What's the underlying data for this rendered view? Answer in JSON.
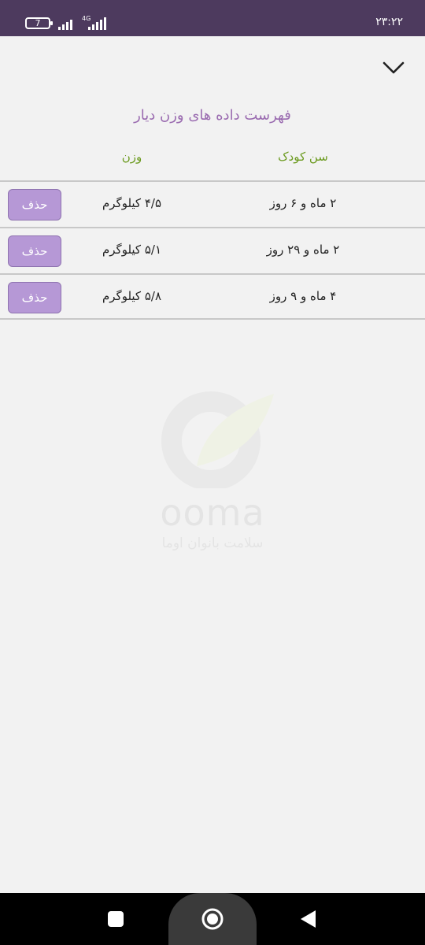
{
  "status_bar": {
    "battery_level": "7",
    "network_type": "4G",
    "time": "۲۳:۲۲"
  },
  "header": {
    "collapse_icon": "chevron-down-icon",
    "title": "فهرست داده های وزن دیار"
  },
  "table": {
    "columns": {
      "age": "سن کودک",
      "weight": "وزن"
    },
    "rows": [
      {
        "age": "۲ ماه و ۶ روز",
        "weight": "۴/۵ کیلوگرم",
        "delete_label": "حذف"
      },
      {
        "age": "۲ ماه و ۲۹ روز",
        "weight": "۵/۱ کیلوگرم",
        "delete_label": "حذف"
      },
      {
        "age": "۴ ماه و ۹ روز",
        "weight": "۵/۸ کیلوگرم",
        "delete_label": "حذف"
      }
    ]
  },
  "watermark": {
    "brand": "ooma",
    "tagline": "سلامت بانوان اوما"
  },
  "nav_bar": {
    "recents_icon": "square-icon",
    "home_icon": "circle-home-icon",
    "back_icon": "triangle-back-icon"
  },
  "colors": {
    "status_bar": "#4d3a5e",
    "title": "#9a6bb0",
    "column_header": "#6b9a1e",
    "delete_button": "#b698d6"
  }
}
